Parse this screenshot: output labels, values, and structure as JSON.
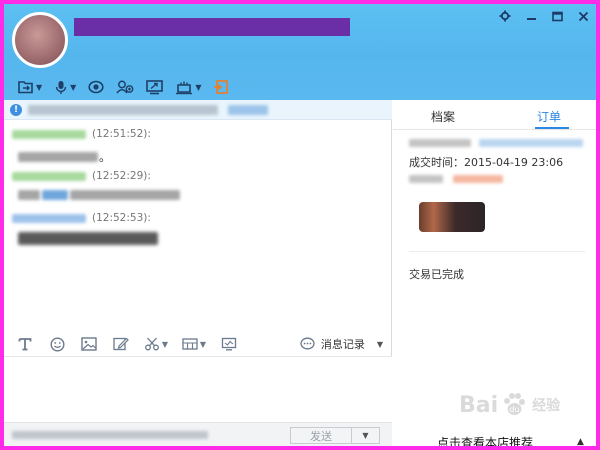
{
  "window": {
    "controls": [
      "settings",
      "minimize",
      "maximize",
      "close"
    ]
  },
  "toolbar": {
    "items": [
      {
        "icon": "file-transfer-icon",
        "has_menu": true
      },
      {
        "icon": "microphone-icon",
        "has_menu": true
      },
      {
        "icon": "eye-icon",
        "has_menu": false
      },
      {
        "icon": "add-contact-icon",
        "has_menu": false
      },
      {
        "icon": "screen-share-icon",
        "has_menu": false
      },
      {
        "icon": "app-center-icon",
        "has_menu": true
      },
      {
        "icon": "exit-icon",
        "has_menu": false
      }
    ]
  },
  "chat": {
    "messages": [
      {
        "time": "(12:51:52):",
        "text": "。"
      },
      {
        "time": "(12:52:29):",
        "text": ""
      },
      {
        "time": "(12:52:53):",
        "text": ""
      }
    ],
    "compose_toolbar": {
      "history_label": "消息记录"
    },
    "send_label": "发送"
  },
  "right": {
    "tabs": [
      {
        "label": "档案",
        "active": false
      },
      {
        "label": "订单",
        "active": true
      }
    ],
    "order_time_label": "成交时间：",
    "order_time_value": "2015-04-19 23:06",
    "order_status": "交易已完成",
    "recommend_label": "点击查看本店推荐"
  },
  "watermark": {
    "brand": "Bai",
    "paw": "du",
    "suffix": "经验"
  },
  "colors": {
    "header": "#5cc0f2",
    "accent": "#2c86e3",
    "frame": "#ff2be6",
    "title_redaction": "#6a2fa7"
  }
}
